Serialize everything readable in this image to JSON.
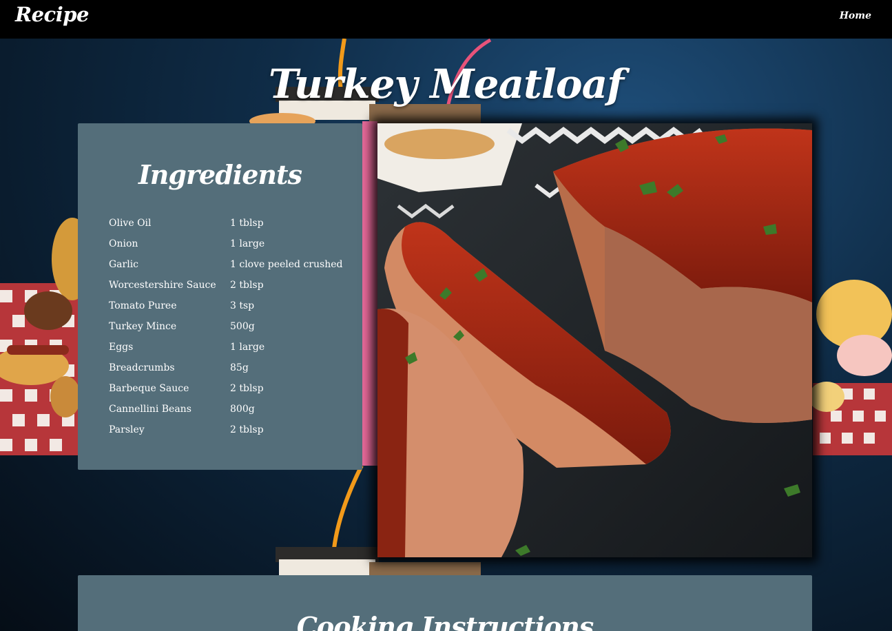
{
  "nav": {
    "brand": "Recipe",
    "home_label": "Home"
  },
  "recipe": {
    "title": "Turkey Meatloaf",
    "ingredients_heading": "Ingredients",
    "instructions_heading": "Cooking Instructions",
    "ingredients": [
      {
        "name": "Olive Oil",
        "amount": "1 tblsp"
      },
      {
        "name": "Onion",
        "amount": "1 large"
      },
      {
        "name": "Garlic",
        "amount": "1 clove peeled crushed"
      },
      {
        "name": "Worcestershire Sauce",
        "amount": "2 tblsp"
      },
      {
        "name": "Tomato Puree",
        "amount": "3 tsp"
      },
      {
        "name": "Turkey Mince",
        "amount": "500g"
      },
      {
        "name": "Eggs",
        "amount": "1 large"
      },
      {
        "name": "Breadcrumbs",
        "amount": "85g"
      },
      {
        "name": "Barbeque Sauce",
        "amount": "2 tblsp"
      },
      {
        "name": "Cannellini Beans",
        "amount": "800g"
      },
      {
        "name": "Parsley",
        "amount": "2 tblsp"
      }
    ]
  },
  "colors": {
    "navbar": "#000000",
    "card": "#546e7a",
    "text": "#ffffff",
    "background": "#0f2c47"
  }
}
